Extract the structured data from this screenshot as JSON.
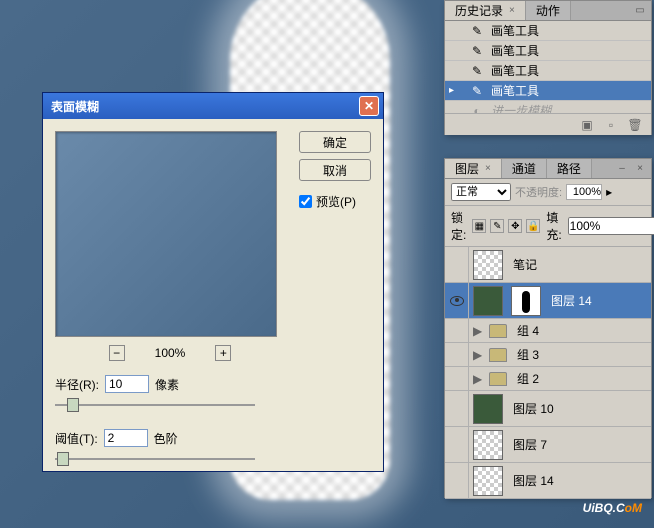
{
  "history": {
    "tabs": [
      "历史记录",
      "动作"
    ],
    "items": [
      {
        "icon": "brush",
        "label": "画笔工具"
      },
      {
        "icon": "brush",
        "label": "画笔工具"
      },
      {
        "icon": "brush",
        "label": "画笔工具"
      },
      {
        "icon": "brush",
        "label": "画笔工具",
        "selected": true,
        "current": true
      },
      {
        "icon": "blur",
        "label": "进一步模糊",
        "dimmed": true
      }
    ]
  },
  "layers": {
    "tabs": [
      "图层",
      "通道",
      "路径"
    ],
    "blend_mode": "正常",
    "opacity_label": "不透明度:",
    "opacity_value": "100%",
    "lock_label": "锁定:",
    "fill_label": "填充:",
    "fill_value": "100%",
    "items": [
      {
        "type": "layer",
        "name": "笔记",
        "thumb": "checker"
      },
      {
        "type": "layer",
        "name": "图层 14",
        "thumb": "img",
        "mask": true,
        "selected": true,
        "visible": true
      },
      {
        "type": "group",
        "name": "组 4"
      },
      {
        "type": "group",
        "name": "组 3"
      },
      {
        "type": "group",
        "name": "组 2"
      },
      {
        "type": "layer",
        "name": "图层 10",
        "thumb": "img"
      },
      {
        "type": "layer",
        "name": "图层 7",
        "thumb": "checker"
      },
      {
        "type": "layer",
        "name": "图层 14",
        "thumb": "checker"
      }
    ]
  },
  "dialog": {
    "title": "表面模糊",
    "ok": "确定",
    "cancel": "取消",
    "preview_label": "预览(P)",
    "zoom": "100%",
    "radius_label": "半径(R):",
    "radius_value": "10",
    "radius_unit": "像素",
    "threshold_label": "阈值(T):",
    "threshold_value": "2",
    "threshold_unit": "色阶"
  },
  "watermark": {
    "text": "UiBQ.C",
    "suffix": "oM"
  }
}
